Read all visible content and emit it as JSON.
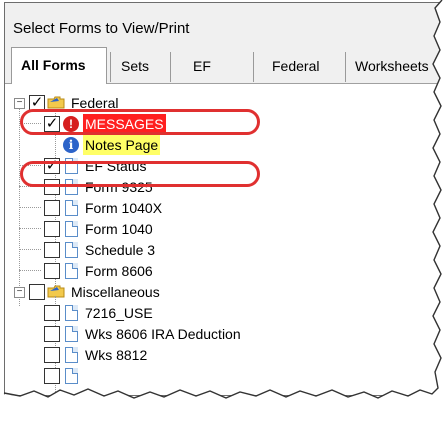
{
  "window": {
    "title": "Select Forms to View/Print"
  },
  "tabs": [
    {
      "label": "All Forms",
      "active": true
    },
    {
      "label": "Sets",
      "active": false
    },
    {
      "label": "EF",
      "active": false
    },
    {
      "label": "Federal",
      "active": false
    },
    {
      "label": "Worksheets",
      "active": false
    }
  ],
  "tree": {
    "groups": [
      {
        "label": "Federal",
        "expanded": true,
        "checked": true,
        "items": [
          {
            "label": "MESSAGES",
            "checked": true,
            "icon": "warning-icon",
            "highlight": "red"
          },
          {
            "label": "Notes Page",
            "checked": false,
            "icon": "info-icon",
            "highlight": "yellow",
            "no_checkbox": true
          },
          {
            "label": "EF Status",
            "checked": true,
            "icon": "document-icon"
          },
          {
            "label": "Form 9325",
            "checked": false,
            "icon": "document-icon"
          },
          {
            "label": "Form 1040X",
            "checked": false,
            "icon": "document-icon"
          },
          {
            "label": "Form 1040",
            "checked": false,
            "icon": "document-icon"
          },
          {
            "label": "Schedule 3",
            "checked": false,
            "icon": "document-icon"
          },
          {
            "label": "Form 8606",
            "checked": false,
            "icon": "document-icon"
          }
        ]
      },
      {
        "label": "Miscellaneous",
        "expanded": true,
        "checked": false,
        "items": [
          {
            "label": "7216_USE",
            "checked": false,
            "icon": "document-icon"
          },
          {
            "label": "Wks 8606 IRA Deduction",
            "checked": false,
            "icon": "document-icon"
          },
          {
            "label": "Wks 8812",
            "checked": false,
            "icon": "document-icon"
          }
        ]
      }
    ]
  },
  "annotation_color": "#e03030",
  "warning_color": "#d61f1f",
  "info_color": "#2c63c9",
  "expander_minus": "⊟",
  "check_mark": "✓",
  "warn_glyph": "!",
  "info_glyph": "i"
}
